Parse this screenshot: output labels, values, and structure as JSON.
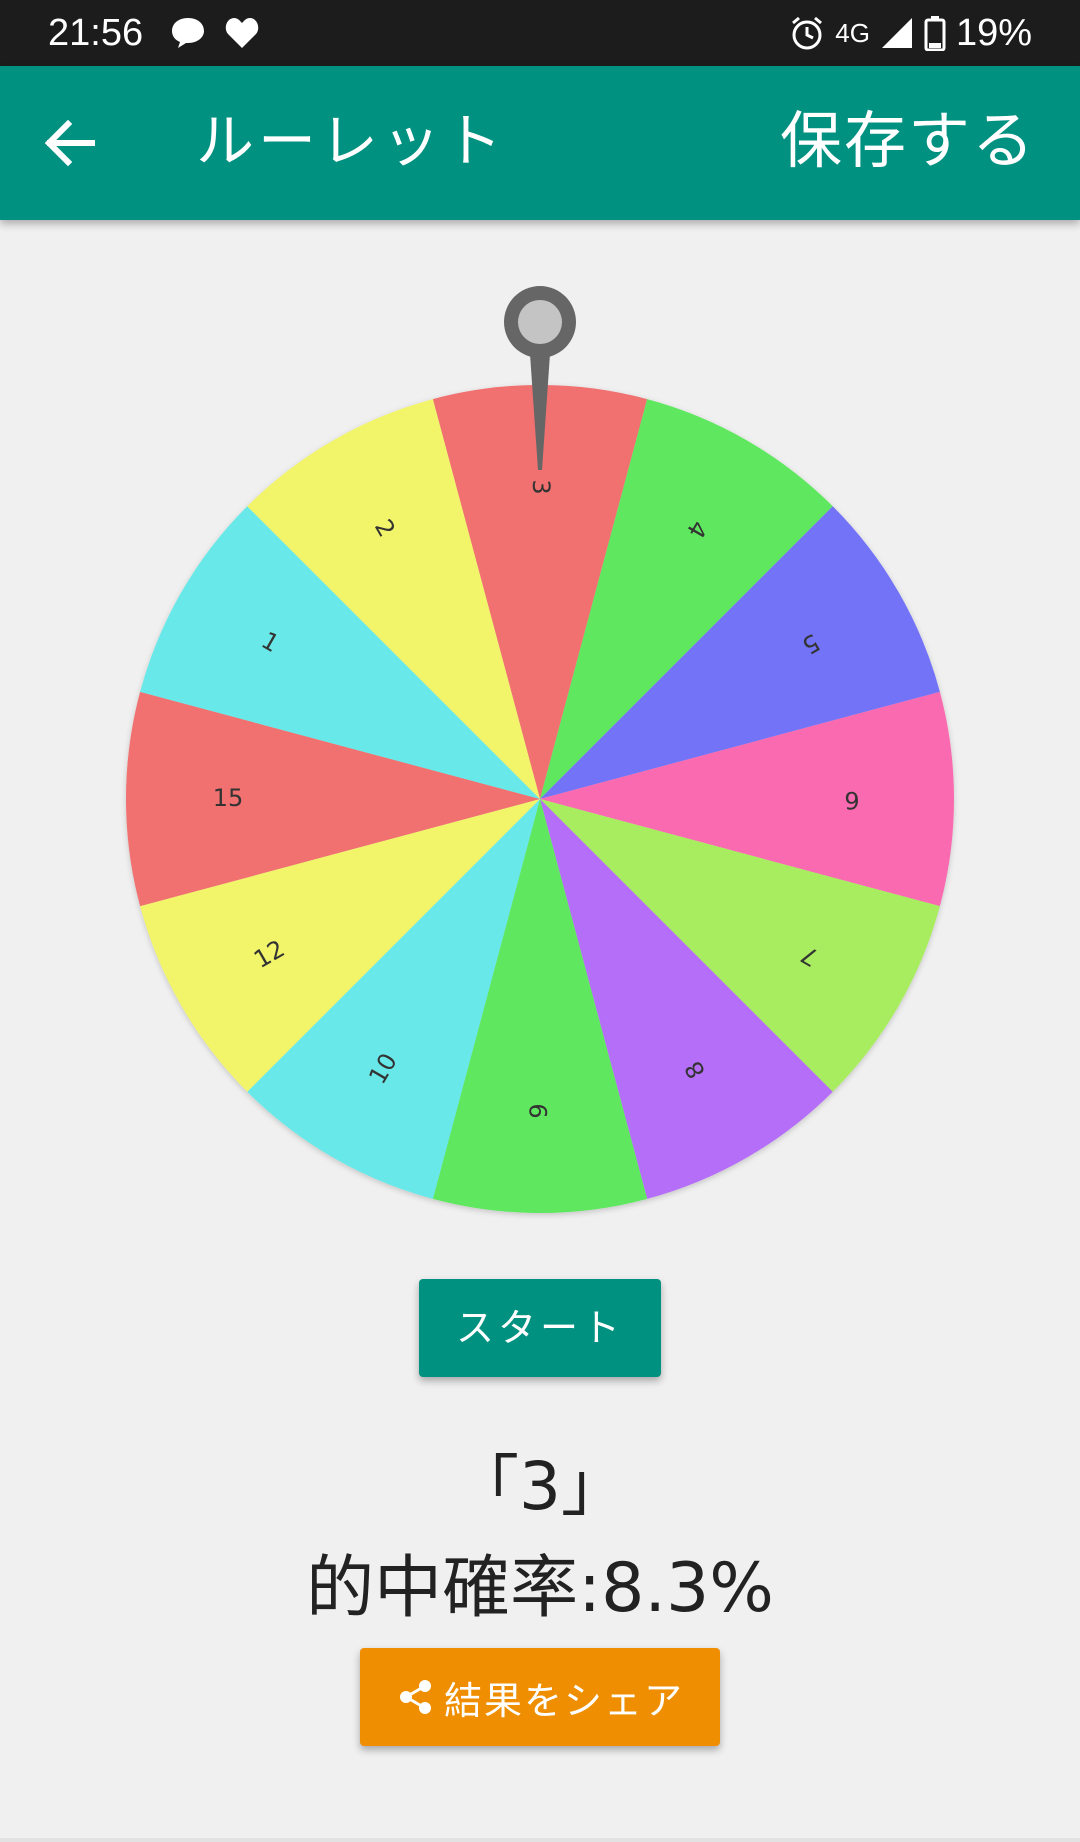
{
  "status_bar": {
    "time": "21:56",
    "left_icons": [
      "chat-bubble-icon",
      "heart-icon"
    ],
    "network": "4G",
    "battery": "19%",
    "right_icons": [
      "alarm-icon",
      "signal-icon",
      "battery-icon"
    ]
  },
  "app_bar": {
    "back_icon": "arrow-left-icon",
    "title": "ルーレット",
    "save_label": "保存する"
  },
  "wheel": {
    "segments": [
      {
        "label": "3",
        "color": "#f17070"
      },
      {
        "label": "4",
        "color": "#5ee85e"
      },
      {
        "label": "5",
        "color": "#7373f8"
      },
      {
        "label": "6",
        "color": "#fa6ab0"
      },
      {
        "label": "7",
        "color": "#a8ec5e"
      },
      {
        "label": "8",
        "color": "#b56ef8"
      },
      {
        "label": "9",
        "color": "#5ee85e"
      },
      {
        "label": "10",
        "color": "#67e8e8"
      },
      {
        "label": "12",
        "color": "#f2f46a"
      },
      {
        "label": "15",
        "color": "#f17070"
      },
      {
        "label": "1",
        "color": "#67e8e8"
      },
      {
        "label": "2",
        "color": "#f2f46a"
      }
    ],
    "pointer_color": "#666666"
  },
  "start_label": "スタート",
  "result": {
    "value": "「3」",
    "probability": "的中確率:8.3%"
  },
  "share": {
    "icon": "share-icon",
    "label": "結果をシェア"
  },
  "colors": {
    "primary": "#009180",
    "accent": "#ef8e00",
    "status_bar": "#1c1c1c",
    "background": "#f0f0f0"
  }
}
